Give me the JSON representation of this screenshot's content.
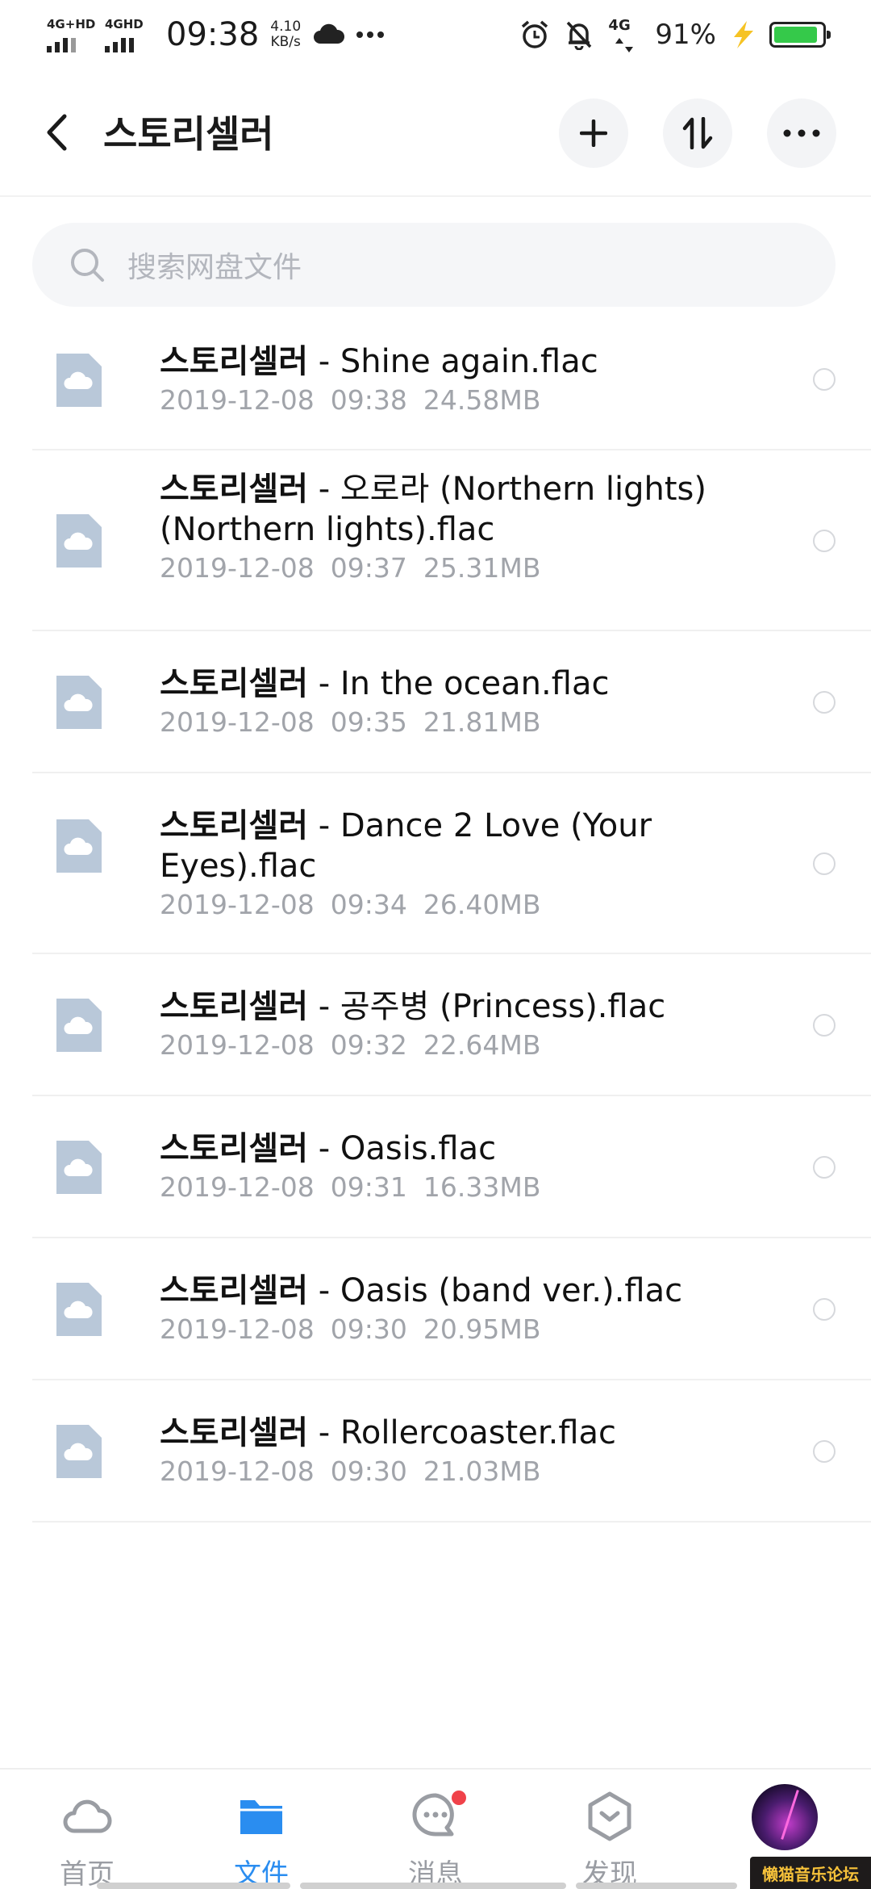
{
  "status_bar": {
    "network_1": "4G+HD",
    "network_2": "4GHD",
    "time": "09:38",
    "speed_value": "4.10",
    "speed_unit": "KB/s",
    "weather_icon": "cloud-icon",
    "more_icon": "more-dots-icon",
    "network_3": "4G",
    "battery_percent": "91%",
    "battery_level": 0.91,
    "battery_color": "#35c94a"
  },
  "header": {
    "title": "스토리셀러",
    "back_icon": "back-chevron-icon",
    "add_icon": "plus-icon",
    "sort_icon": "sort-icon",
    "more_icon": "more-dots-icon"
  },
  "search": {
    "placeholder": "搜索网盘文件",
    "icon": "search-icon"
  },
  "files": [
    {
      "artist": "스토리셀러",
      "title": "- Shine again.flac",
      "date": "2019-12-08",
      "time": "09:38",
      "size": "24.58MB"
    },
    {
      "artist": "스토리셀러",
      "title": "- 오로라 (Northern lights) (Northern lights).flac",
      "date": "2019-12-08",
      "time": "09:37",
      "size": "25.31MB"
    },
    {
      "artist": "스토리셀러",
      "title": "- In the ocean.flac",
      "date": "2019-12-08",
      "time": "09:35",
      "size": "21.81MB"
    },
    {
      "artist": "스토리셀러",
      "title": "- Dance 2 Love (Your Eyes).flac",
      "date": "2019-12-08",
      "time": "09:34",
      "size": "26.40MB"
    },
    {
      "artist": "스토리셀러",
      "title": "- 공주병 (Princess).flac",
      "date": "2019-12-08",
      "time": "09:32",
      "size": "22.64MB"
    },
    {
      "artist": "스토리셀러",
      "title": "- Oasis.flac",
      "date": "2019-12-08",
      "time": "09:31",
      "size": "16.33MB"
    },
    {
      "artist": "스토리셀러",
      "title": "- Oasis (band ver.).flac",
      "date": "2019-12-08",
      "time": "09:30",
      "size": "20.95MB"
    },
    {
      "artist": "스토리셀러",
      "title": "- Rollercoaster.flac",
      "date": "2019-12-08",
      "time": "09:30",
      "size": "21.03MB"
    }
  ],
  "nav": {
    "home": {
      "label": "首页",
      "icon": "cloud-icon"
    },
    "files": {
      "label": "文件",
      "icon": "folder-icon"
    },
    "messages": {
      "label": "消息",
      "icon": "chat-bubble-icon"
    },
    "discover": {
      "label": "发现",
      "icon": "discover-icon"
    },
    "profile": {
      "icon": "avatar"
    }
  },
  "watermark": "懒猫音乐论坛",
  "colors": {
    "accent": "#2a8df0",
    "badge": "#f0424a",
    "file_icon": "#b9c8d9",
    "meta_text": "#a1a4aa"
  }
}
